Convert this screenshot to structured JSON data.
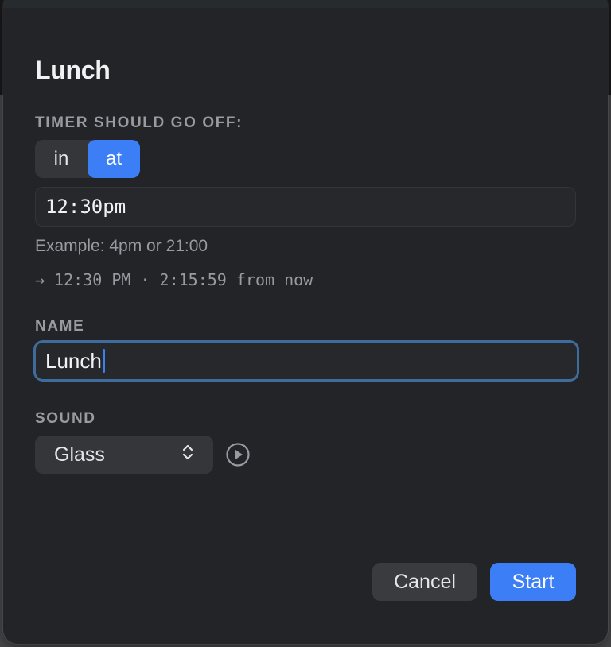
{
  "dialog": {
    "title": "Lunch"
  },
  "timer": {
    "section_label": "TIMER SHOULD GO OFF:",
    "mode_options": [
      "in",
      "at"
    ],
    "selected_mode": "at",
    "time_value": "12:30pm",
    "example_text": "Example: 4pm or 21:00",
    "resolved_text": "→ 12:30 PM · 2:15:59 from now"
  },
  "name": {
    "section_label": "NAME",
    "value": "Lunch"
  },
  "sound": {
    "section_label": "SOUND",
    "selected": "Glass",
    "select_icon": "chevron-up-down-icon",
    "preview_icon": "play-circle-icon"
  },
  "actions": {
    "cancel_label": "Cancel",
    "start_label": "Start"
  },
  "colors": {
    "accent": "#3b7ef6",
    "focus_ring": "#3e6c9c",
    "background": "#232428"
  }
}
